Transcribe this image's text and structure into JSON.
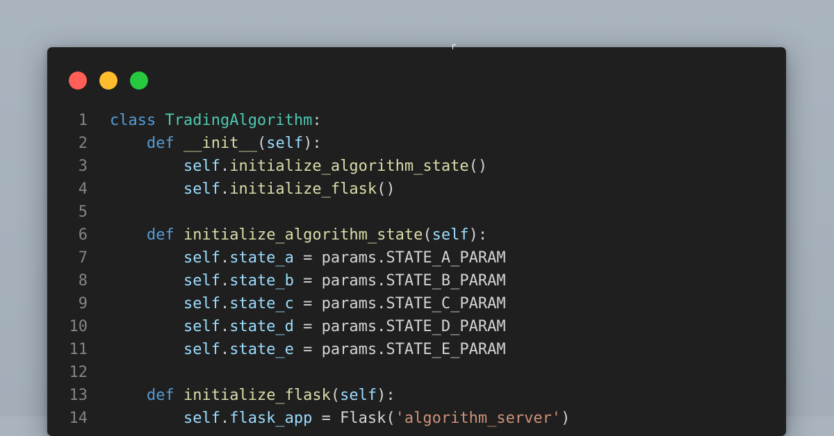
{
  "window": {
    "traffic_lights": [
      {
        "name": "close-button",
        "color": "#ff5f56"
      },
      {
        "name": "minimize-button",
        "color": "#ffbd2e"
      },
      {
        "name": "maximize-button",
        "color": "#27c93f"
      }
    ]
  },
  "code": {
    "lines": [
      {
        "num": "1",
        "tokens": [
          [
            "kw",
            "class"
          ],
          [
            "txt",
            " "
          ],
          [
            "cls",
            "TradingAlgorithm"
          ],
          [
            "txt",
            ":"
          ]
        ]
      },
      {
        "num": "2",
        "tokens": [
          [
            "txt",
            "    "
          ],
          [
            "kw",
            "def"
          ],
          [
            "txt",
            " "
          ],
          [
            "fn",
            "__init__"
          ],
          [
            "txt",
            "("
          ],
          [
            "self",
            "self"
          ],
          [
            "txt",
            "):"
          ]
        ]
      },
      {
        "num": "3",
        "tokens": [
          [
            "txt",
            "        "
          ],
          [
            "self",
            "self"
          ],
          [
            "txt",
            "."
          ],
          [
            "fn",
            "initialize_algorithm_state"
          ],
          [
            "txt",
            "()"
          ]
        ]
      },
      {
        "num": "4",
        "tokens": [
          [
            "txt",
            "        "
          ],
          [
            "self",
            "self"
          ],
          [
            "txt",
            "."
          ],
          [
            "fn",
            "initialize_flask"
          ],
          [
            "txt",
            "()"
          ]
        ]
      },
      {
        "num": "5",
        "tokens": []
      },
      {
        "num": "6",
        "tokens": [
          [
            "txt",
            "    "
          ],
          [
            "kw",
            "def"
          ],
          [
            "txt",
            " "
          ],
          [
            "fn",
            "initialize_algorithm_state"
          ],
          [
            "txt",
            "("
          ],
          [
            "self",
            "self"
          ],
          [
            "txt",
            "):"
          ]
        ]
      },
      {
        "num": "7",
        "tokens": [
          [
            "txt",
            "        "
          ],
          [
            "self",
            "self"
          ],
          [
            "txt",
            "."
          ],
          [
            "self",
            "state_a"
          ],
          [
            "txt",
            " = params.STATE_A_PARAM"
          ]
        ]
      },
      {
        "num": "8",
        "tokens": [
          [
            "txt",
            "        "
          ],
          [
            "self",
            "self"
          ],
          [
            "txt",
            "."
          ],
          [
            "self",
            "state_b"
          ],
          [
            "txt",
            " = params.STATE_B_PARAM"
          ]
        ]
      },
      {
        "num": "9",
        "tokens": [
          [
            "txt",
            "        "
          ],
          [
            "self",
            "self"
          ],
          [
            "txt",
            "."
          ],
          [
            "self",
            "state_c"
          ],
          [
            "txt",
            " = params.STATE_C_PARAM"
          ]
        ]
      },
      {
        "num": "10",
        "tokens": [
          [
            "txt",
            "        "
          ],
          [
            "self",
            "self"
          ],
          [
            "txt",
            "."
          ],
          [
            "self",
            "state_d"
          ],
          [
            "txt",
            " = params.STATE_D_PARAM"
          ]
        ]
      },
      {
        "num": "11",
        "tokens": [
          [
            "txt",
            "        "
          ],
          [
            "self",
            "self"
          ],
          [
            "txt",
            "."
          ],
          [
            "self",
            "state_e"
          ],
          [
            "txt",
            " = params.STATE_E_PARAM"
          ]
        ]
      },
      {
        "num": "12",
        "tokens": []
      },
      {
        "num": "13",
        "tokens": [
          [
            "txt",
            "    "
          ],
          [
            "kw",
            "def"
          ],
          [
            "txt",
            " "
          ],
          [
            "fn",
            "initialize_flask"
          ],
          [
            "txt",
            "("
          ],
          [
            "self",
            "self"
          ],
          [
            "txt",
            "):"
          ]
        ]
      },
      {
        "num": "14",
        "tokens": [
          [
            "txt",
            "        "
          ],
          [
            "self",
            "self"
          ],
          [
            "txt",
            "."
          ],
          [
            "self",
            "flask_app"
          ],
          [
            "txt",
            " = Flask("
          ],
          [
            "str",
            "'algorithm_server'"
          ],
          [
            "txt",
            ")"
          ]
        ]
      }
    ]
  },
  "colors": {
    "background": "#a7b2bd",
    "window": "#1f1f1f",
    "keyword": "#569cd6",
    "class_name": "#4ec9b0",
    "function": "#dcdcaa",
    "variable": "#9cdcfe",
    "string": "#ce9178",
    "text": "#d4d4d4",
    "line_number": "#858585"
  }
}
